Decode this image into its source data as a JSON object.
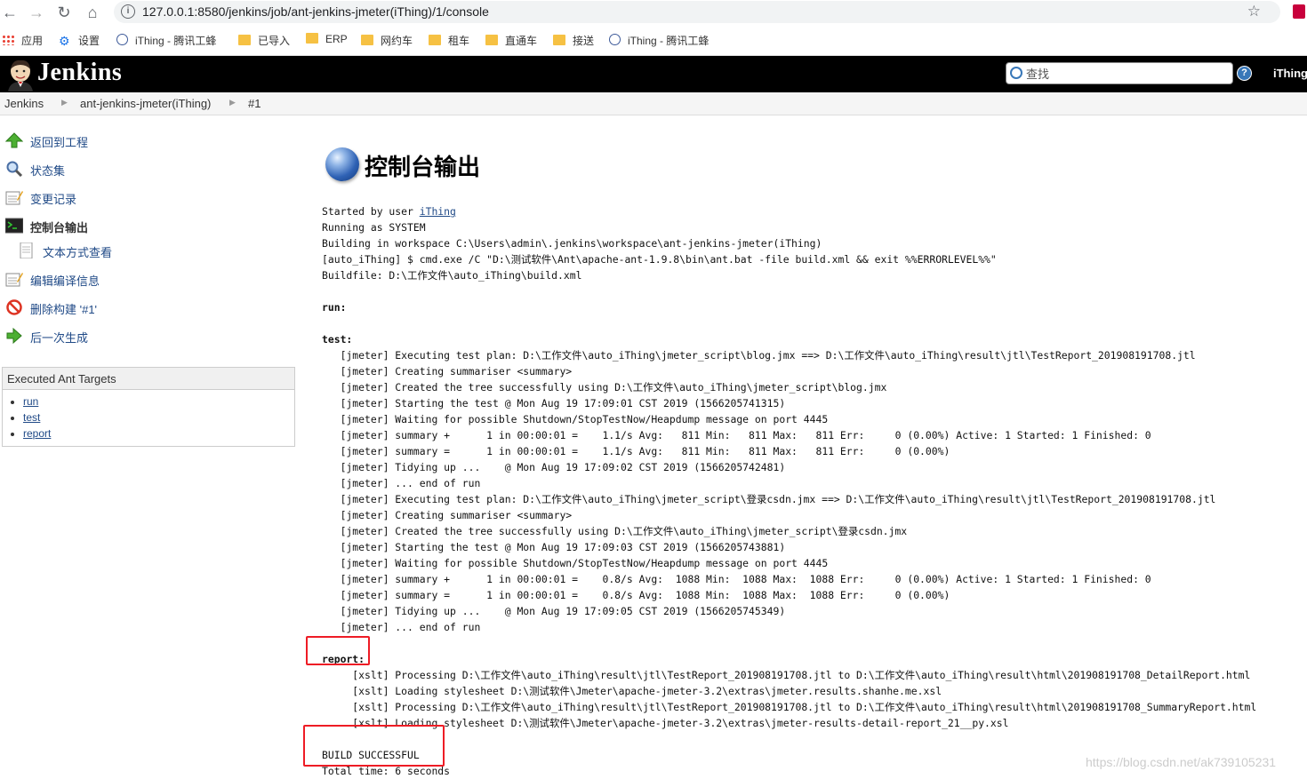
{
  "browser": {
    "url": "127.0.0.1:8580/jenkins/job/ant-jenkins-jmeter(iThing)/1/console",
    "bookmarks": [
      {
        "label": "应用",
        "icon": "apps-grid-icon"
      },
      {
        "label": "设置",
        "icon": "gear-icon"
      },
      {
        "label": "iThing - 腾讯工蜂",
        "icon": "globe-icon"
      },
      {
        "label": "已导入",
        "icon": "folder-icon"
      },
      {
        "label": "ERP",
        "icon": "folder-icon"
      },
      {
        "label": "网约车",
        "icon": "folder-icon"
      },
      {
        "label": "租车",
        "icon": "folder-icon"
      },
      {
        "label": "直通车",
        "icon": "folder-icon"
      },
      {
        "label": "接送",
        "icon": "folder-icon"
      },
      {
        "label": "iThing - 腾讯工蜂",
        "icon": "globe-icon"
      }
    ]
  },
  "header": {
    "title": "Jenkins",
    "search_placeholder": "查找",
    "help": "?",
    "user": "iThing"
  },
  "breadcrumb": [
    "Jenkins",
    "ant-jenkins-jmeter(iThing)",
    "#1"
  ],
  "sidebar": {
    "tasks": [
      {
        "label": "返回到工程",
        "icon": "up-arrow-icon"
      },
      {
        "label": "状态集",
        "icon": "magnifier-icon"
      },
      {
        "label": "变更记录",
        "icon": "notepad-icon"
      },
      {
        "label": "控制台输出",
        "icon": "terminal-icon"
      },
      {
        "label": "文本方式查看",
        "icon": "document-icon"
      },
      {
        "label": "编辑编译信息",
        "icon": "notepad-icon"
      },
      {
        "label": "删除构建 '#1'",
        "icon": "no-entry-icon"
      },
      {
        "label": "后一次生成",
        "icon": "right-arrow-icon"
      }
    ],
    "ant_panel": {
      "title": "Executed Ant Targets",
      "targets": [
        "run",
        "test",
        "report"
      ]
    }
  },
  "main": {
    "title": "控制台输出",
    "started_prefix": "Started by user ",
    "started_user": "iThing",
    "lines": [
      "Running as SYSTEM",
      "Building in workspace C:\\Users\\admin\\.jenkins\\workspace\\ant-jenkins-jmeter(iThing)",
      "[auto_iThing] $ cmd.exe /C \"D:\\测试软件\\Ant\\apache-ant-1.9.8\\bin\\ant.bat -file build.xml && exit %%ERRORLEVEL%%\"",
      "Buildfile: D:\\工作文件\\auto_iThing\\build.xml",
      "",
      "run:",
      "",
      "test:",
      "   [jmeter] Executing test plan: D:\\工作文件\\auto_iThing\\jmeter_script\\blog.jmx ==> D:\\工作文件\\auto_iThing\\result\\jtl\\TestReport_201908191708.jtl",
      "   [jmeter] Creating summariser <summary>",
      "   [jmeter] Created the tree successfully using D:\\工作文件\\auto_iThing\\jmeter_script\\blog.jmx",
      "   [jmeter] Starting the test @ Mon Aug 19 17:09:01 CST 2019 (1566205741315)",
      "   [jmeter] Waiting for possible Shutdown/StopTestNow/Heapdump message on port 4445",
      "   [jmeter] summary +      1 in 00:00:01 =    1.1/s Avg:   811 Min:   811 Max:   811 Err:     0 (0.00%) Active: 1 Started: 1 Finished: 0",
      "   [jmeter] summary =      1 in 00:00:01 =    1.1/s Avg:   811 Min:   811 Max:   811 Err:     0 (0.00%)",
      "   [jmeter] Tidying up ...    @ Mon Aug 19 17:09:02 CST 2019 (1566205742481)",
      "   [jmeter] ... end of run",
      "   [jmeter] Executing test plan: D:\\工作文件\\auto_iThing\\jmeter_script\\登录csdn.jmx ==> D:\\工作文件\\auto_iThing\\result\\jtl\\TestReport_201908191708.jtl",
      "   [jmeter] Creating summariser <summary>",
      "   [jmeter] Created the tree successfully using D:\\工作文件\\auto_iThing\\jmeter_script\\登录csdn.jmx",
      "   [jmeter] Starting the test @ Mon Aug 19 17:09:03 CST 2019 (1566205743881)",
      "   [jmeter] Waiting for possible Shutdown/StopTestNow/Heapdump message on port 4445",
      "   [jmeter] summary +      1 in 00:00:01 =    0.8/s Avg:  1088 Min:  1088 Max:  1088 Err:     0 (0.00%) Active: 1 Started: 1 Finished: 0",
      "   [jmeter] summary =      1 in 00:00:01 =    0.8/s Avg:  1088 Min:  1088 Max:  1088 Err:     0 (0.00%)",
      "   [jmeter] Tidying up ...    @ Mon Aug 19 17:09:05 CST 2019 (1566205745349)",
      "   [jmeter] ... end of run",
      "",
      "report:",
      "     [xslt] Processing D:\\工作文件\\auto_iThing\\result\\jtl\\TestReport_201908191708.jtl to D:\\工作文件\\auto_iThing\\result\\html\\201908191708_DetailReport.html",
      "     [xslt] Loading stylesheet D:\\测试软件\\Jmeter\\apache-jmeter-3.2\\extras\\jmeter.results.shanhe.me.xsl",
      "     [xslt] Processing D:\\工作文件\\auto_iThing\\result\\jtl\\TestReport_201908191708.jtl to D:\\工作文件\\auto_iThing\\result\\html\\201908191708_SummaryReport.html",
      "     [xslt] Loading stylesheet D:\\测试软件\\Jmeter\\apache-jmeter-3.2\\extras\\jmeter-results-detail-report_21__py.xsl",
      "",
      "BUILD SUCCESSFUL",
      "Total time: 6 seconds"
    ]
  },
  "watermark": "https://blog.csdn.net/ak739105231",
  "colors": {
    "highlight_box": "#ee1c25",
    "link": "#204a87",
    "header_bg": "#000000"
  }
}
